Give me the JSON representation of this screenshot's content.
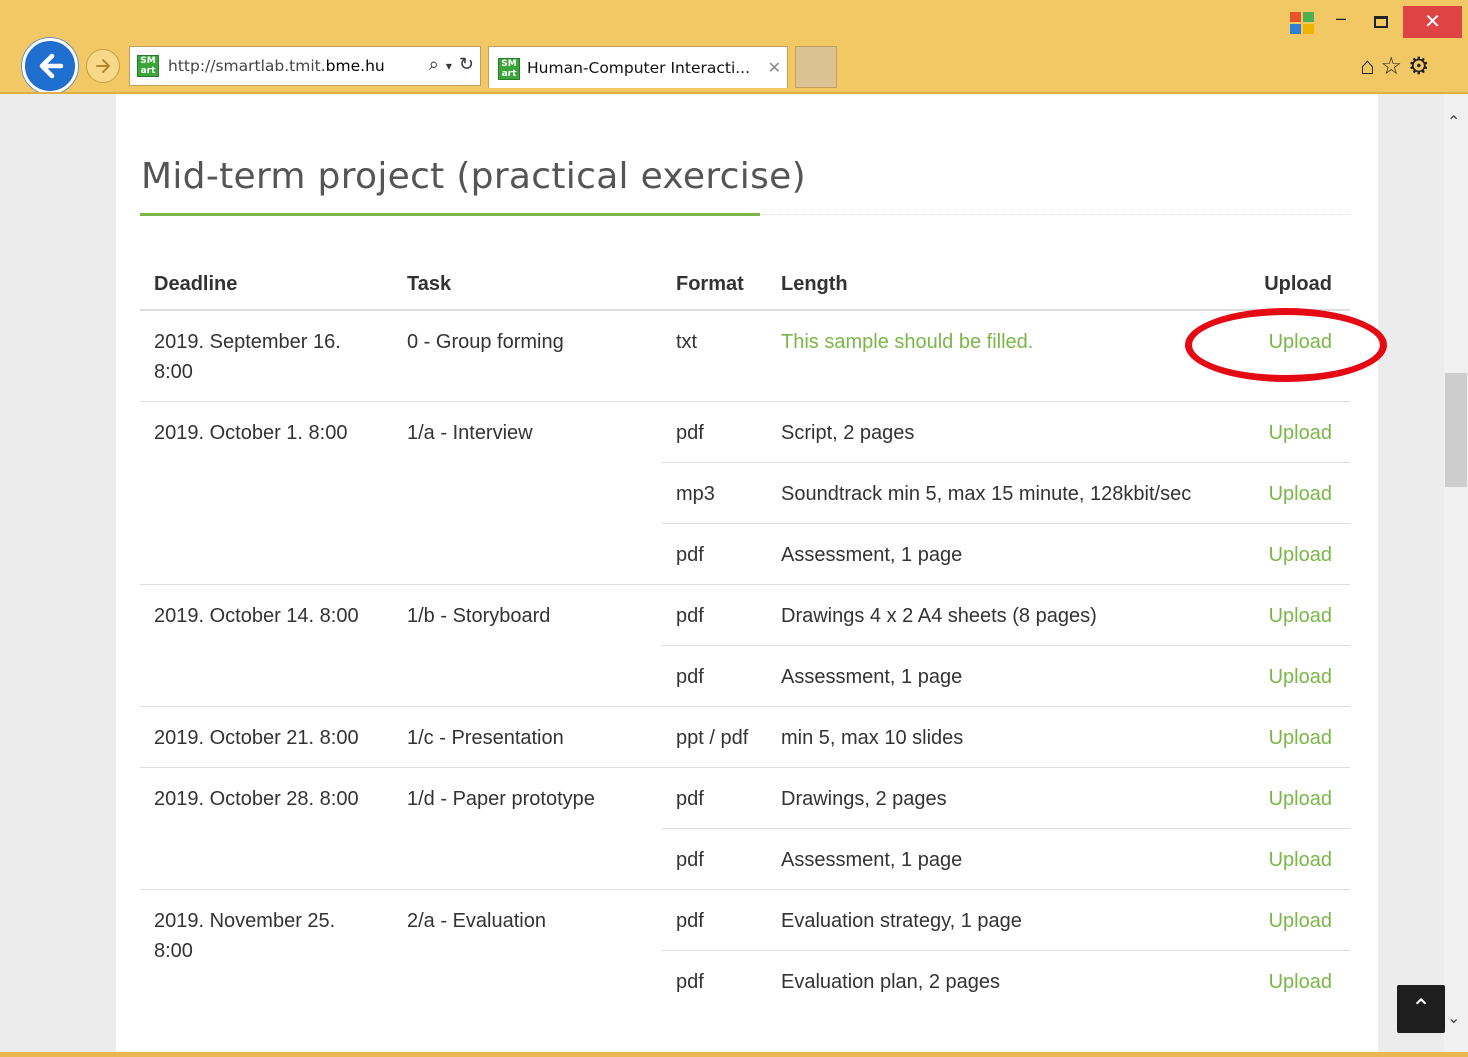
{
  "browser": {
    "url_prefix": "http://smartlab.tmit.",
    "url_domain": "bme.hu",
    "tab_title": "Human-Computer Interacti...",
    "favicon_text_top": "SM",
    "favicon_text_bottom": "art",
    "accent_color": "#f2c864"
  },
  "page": {
    "title": "Mid-term project (practical exercise)",
    "accent_color": "#7ab648"
  },
  "table": {
    "headers": {
      "deadline": "Deadline",
      "task": "Task",
      "format": "Format",
      "length": "Length",
      "upload": "Upload"
    },
    "rows": [
      {
        "deadline": "2019. September 16. 8:00",
        "task": "0 - Group forming",
        "format": "txt",
        "length": "This sample should be filled.",
        "upload": "Upload"
      },
      {
        "deadline": "2019. October 1. 8:00",
        "task": "1/a - Interview",
        "format": "pdf",
        "length": "Script, 2 pages",
        "upload": "Upload"
      },
      {
        "deadline": "",
        "task": "",
        "format": "mp3",
        "length": "Soundtrack min 5, max 15 minute, 128kbit/sec",
        "upload": "Upload"
      },
      {
        "deadline": "",
        "task": "",
        "format": "pdf",
        "length": "Assessment, 1 page",
        "upload": "Upload"
      },
      {
        "deadline": "2019. October 14. 8:00",
        "task": "1/b - Storyboard",
        "format": "pdf",
        "length": "Drawings 4 x 2 A4 sheets (8 pages)",
        "upload": "Upload"
      },
      {
        "deadline": "",
        "task": "",
        "format": "pdf",
        "length": "Assessment, 1 page",
        "upload": "Upload"
      },
      {
        "deadline": "2019. October 21. 8:00",
        "task": "1/c - Presentation",
        "format": "ppt / pdf",
        "length": "min 5, max 10 slides",
        "upload": "Upload"
      },
      {
        "deadline": "2019. October 28. 8:00",
        "task": "1/d - Paper prototype",
        "format": "pdf",
        "length": "Drawings, 2 pages",
        "upload": "Upload"
      },
      {
        "deadline": "",
        "task": "",
        "format": "pdf",
        "length": "Assessment, 1 page",
        "upload": "Upload"
      },
      {
        "deadline": "2019. November 25. 8:00",
        "task": "2/a - Evaluation",
        "format": "pdf",
        "length": "Evaluation strategy, 1 page",
        "upload": "Upload"
      },
      {
        "deadline": "",
        "task": "",
        "format": "pdf",
        "length": "Evaluation plan, 2 pages",
        "upload": "Upload"
      }
    ]
  }
}
